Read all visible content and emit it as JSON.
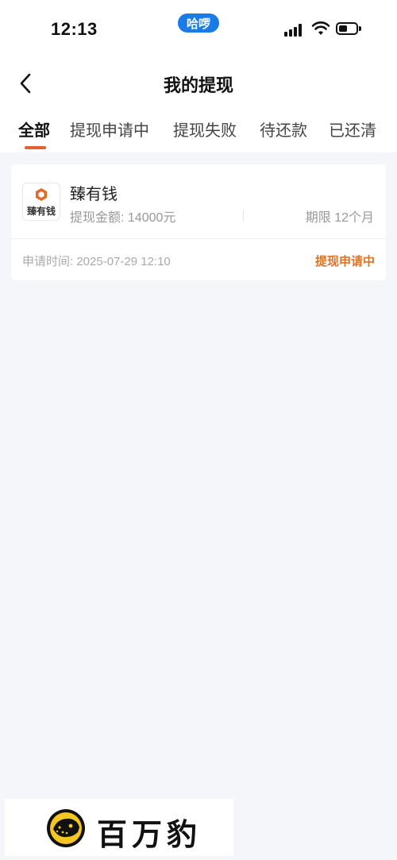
{
  "status_bar": {
    "time": "12:13",
    "carrier_pill": "哈啰"
  },
  "nav": {
    "title": "我的提现"
  },
  "tabs": [
    {
      "label": "全部",
      "active": true
    },
    {
      "label": "提现申请中",
      "active": false
    },
    {
      "label": "提现失败",
      "active": false
    },
    {
      "label": "待还款",
      "active": false
    },
    {
      "label": "已还清",
      "active": false
    }
  ],
  "records": [
    {
      "logo_text": "臻有钱",
      "name": "臻有钱",
      "amount": "提现金额: 14000元",
      "term": "期限 12个月",
      "apply_time": "申请时间:  2025-07-29  12:10",
      "status": "提现申请中"
    }
  ],
  "watermark": {
    "brand": "百万豹"
  },
  "colors": {
    "accent": "#e0612f",
    "status_orange": "#d9742b",
    "pill_blue": "#1a7ae6",
    "background": "#f5f6f9"
  }
}
